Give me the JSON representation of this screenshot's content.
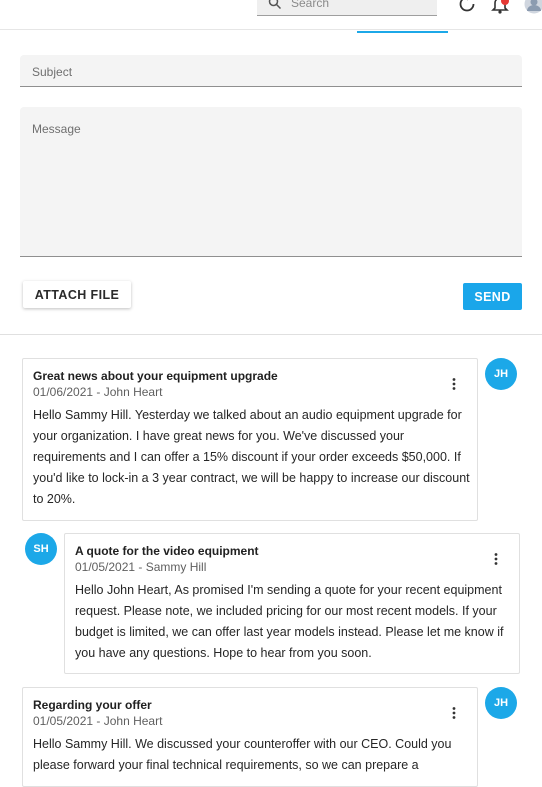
{
  "header": {
    "search_placeholder": "Search",
    "icons": [
      "search-icon",
      "refresh-icon",
      "notifications-icon",
      "user-avatar"
    ]
  },
  "compose": {
    "subject_placeholder": "Subject",
    "message_placeholder": "Message",
    "attach_label": "ATTACH FILE",
    "send_label": "SEND"
  },
  "messages": [
    {
      "title": "Great news about your equipment upgrade",
      "meta": "01/06/2021 - John Heart",
      "body": "Hello Sammy Hill. Yesterday we talked about an audio equipment upgrade for your organization. I have great news for you. We've discussed your requirements and I can offer a 15% discount if your order exceeds $50,000. If you'd like to lock-in a 3 year contract, we will be happy to increase our discount to 20%.",
      "initials": "JH"
    },
    {
      "title": "A quote for the video equipment",
      "meta": "01/05/2021 - Sammy Hill",
      "body": "Hello John Heart, As promised I'm sending a quote for your recent equipment request. Please note, we included pricing for our most recent models. If your budget is limited, we can offer last year models instead. Please let me know if you have any questions. Hope to hear from you soon.",
      "initials": "SH"
    },
    {
      "title": "Regarding your offer",
      "meta": "01/05/2021 - John Heart",
      "body": "Hello Sammy Hill. We discussed your counteroffer with our CEO. Could you please forward your final technical requirements, so we can prepare a",
      "initials": "JH"
    }
  ],
  "colors": {
    "accent": "#1ca8e8",
    "send_button": "#1aa6ea",
    "notification_badge": "#e53935"
  }
}
